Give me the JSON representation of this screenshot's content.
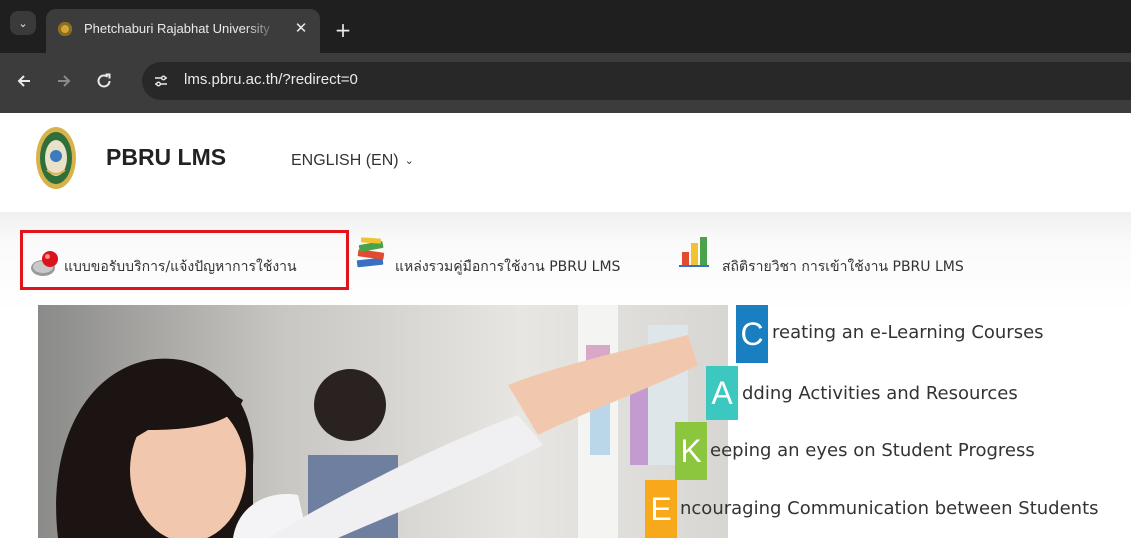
{
  "browser": {
    "tab_title": "Phetchaburi Rajabhat University",
    "tab_close": "✕",
    "new_tab": "+",
    "tab_list": "⌄",
    "url": "lms.pbru.ac.th/?redirect=0"
  },
  "header": {
    "site_name": "PBRU LMS",
    "language": "ENGLISH (EN)"
  },
  "links": [
    {
      "label": "แบบขอรับบริการ/แจ้งปัญหาการใช้งาน",
      "icon": "red-pin-icon"
    },
    {
      "label": "แหล่งรวมคู่มือการใช้งาน PBRU LMS",
      "icon": "books-icon"
    },
    {
      "label": "สถิติรายวิชา การเข้าใช้งาน PBRU LMS",
      "icon": "bar-chart-icon"
    }
  ],
  "banner": {
    "rows": [
      {
        "letter": "C",
        "text": "reating an e-Learning Courses",
        "color": "#1a7fc0"
      },
      {
        "letter": "A",
        "text": "dding Activities and Resources",
        "color": "#3cc8c0"
      },
      {
        "letter": "K",
        "text": "eeping an eyes on Student Progress",
        "color": "#8cc63f"
      },
      {
        "letter": "E",
        "text": "ncouraging Communication between Students",
        "color": "#f7a81b"
      }
    ]
  },
  "colors": {
    "highlight": "#e3131b",
    "tabbar": "#1f1f1f",
    "toolbar": "#3c3c3c"
  }
}
